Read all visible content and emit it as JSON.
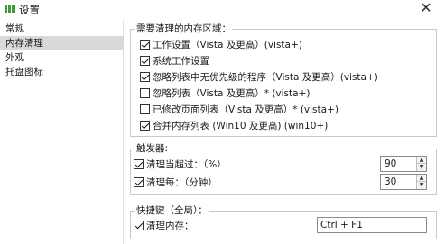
{
  "window": {
    "title": "设置",
    "close_glyph": "✕"
  },
  "sidebar": {
    "items": [
      {
        "label": "常规",
        "selected": false
      },
      {
        "label": "内存清理",
        "selected": true
      },
      {
        "label": "外观",
        "selected": false
      },
      {
        "label": "托盘图标",
        "selected": false
      }
    ]
  },
  "memory_areas": {
    "title": "需要清理的内存区域：",
    "items": [
      {
        "label": "工作设置（Vista 及更高）(vista+)",
        "checked": true
      },
      {
        "label": "系统工作设置",
        "checked": true
      },
      {
        "label": "忽略列表中无优先级的程序（Vista 及更高）(vista+)",
        "checked": true
      },
      {
        "label": "忽略列表（Vista 及更高）* (vista+)",
        "checked": false
      },
      {
        "label": "已修改页面列表（Vista 及更高）* (vista+)",
        "checked": false
      },
      {
        "label": "合并内存列表 (Win10 及更高) (win10+)",
        "checked": true
      }
    ]
  },
  "triggers": {
    "title": "触发器:",
    "usage": {
      "label": "清理当超过：（%）",
      "checked": true,
      "value": "90"
    },
    "interval": {
      "label": "清理每：（分钟）",
      "checked": true,
      "value": "30"
    }
  },
  "hotkey": {
    "title": "快捷键（全局）：",
    "label": "清理内存：",
    "checked": true,
    "value": "Ctrl + F1"
  },
  "colors": {
    "selected_background": "#d9d9d9",
    "app_icon_green": "#3a9a3a"
  },
  "icons": {
    "app": "app-icon",
    "close": "close-icon",
    "spin_up": "▲",
    "spin_down": "▼"
  }
}
